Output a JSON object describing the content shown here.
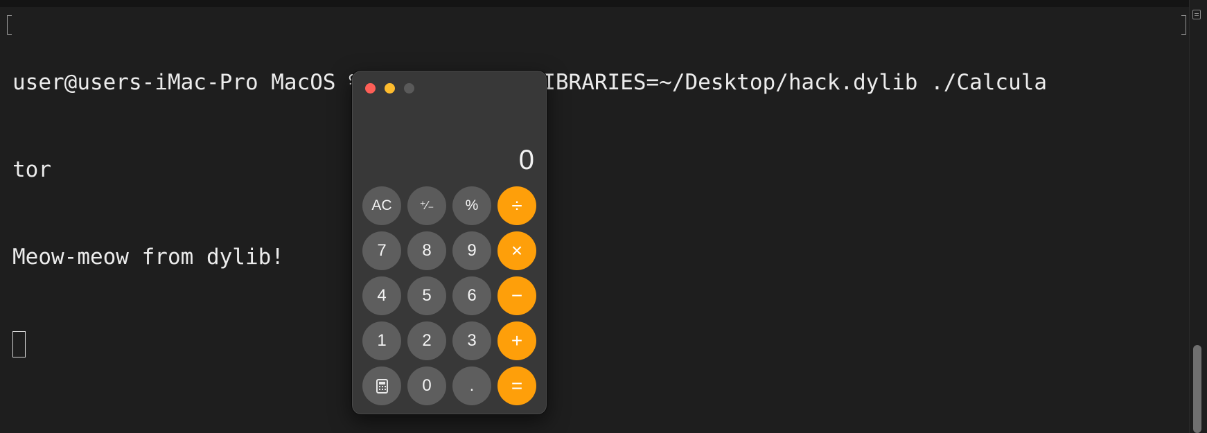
{
  "terminal": {
    "lines": [
      "user@users-iMac-Pro MacOS % DYLD_INSERT_LIBRARIES=~/Desktop/hack.dylib ./Calcula",
      "tor",
      "Meow-meow from dylib!"
    ]
  },
  "calculator": {
    "display": "0",
    "keys": {
      "ac": "AC",
      "plus_minus": "⁺∕₋",
      "percent": "%",
      "divide": "÷",
      "seven": "7",
      "eight": "8",
      "nine": "9",
      "multiply": "×",
      "four": "4",
      "five": "5",
      "six": "6",
      "minus": "−",
      "one": "1",
      "two": "2",
      "three": "3",
      "plus": "+",
      "zero": "0",
      "decimal": ".",
      "equals": "="
    },
    "colors": {
      "operator": "#fe9f0a",
      "close": "#fe5f57",
      "minimize": "#febc2e"
    }
  },
  "icons": {
    "mode_toggle": "calculator-icon",
    "scroll_marks": "marks-icon"
  }
}
